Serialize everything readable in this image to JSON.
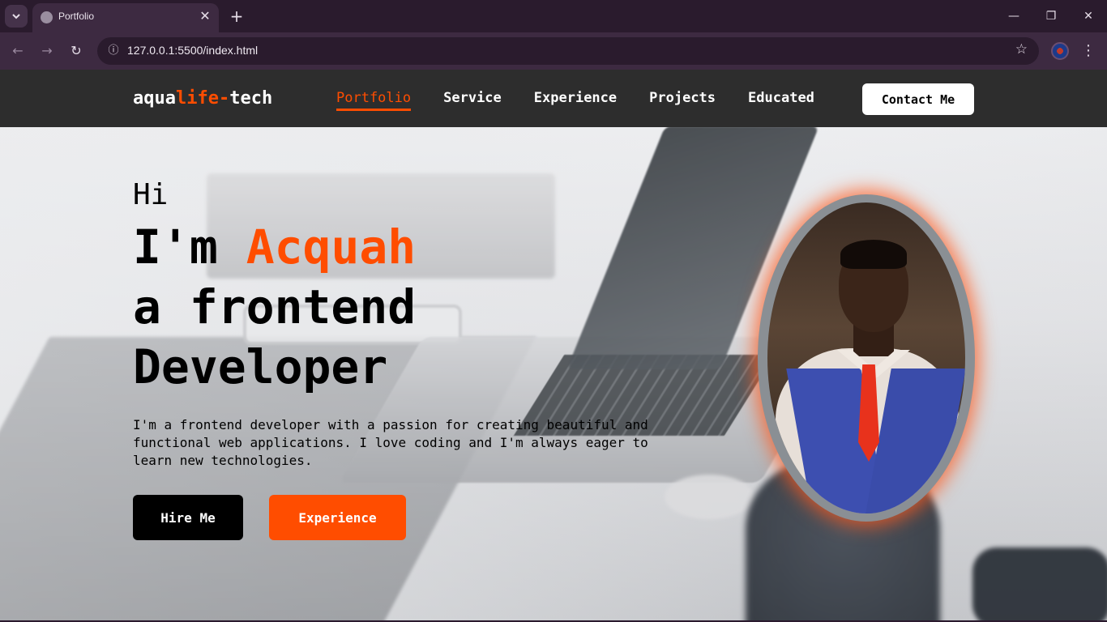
{
  "browser": {
    "tab_title": "Portfolio",
    "url": "127.0.0.1:5500/index.html",
    "icons": {
      "tab_list": "chevron-down-icon",
      "tab_close": "close-icon",
      "new_tab": "plus-icon",
      "back": "arrow-left-icon",
      "forward": "arrow-right-icon",
      "reload": "reload-icon",
      "site_info": "info-icon",
      "bookmark": "star-icon",
      "menu": "kebab-icon"
    }
  },
  "site": {
    "logo": {
      "part1": "aqua",
      "part2": "life-",
      "part3": "tech"
    },
    "nav": [
      {
        "label": "Portfolio",
        "active": true
      },
      {
        "label": "Service",
        "active": false
      },
      {
        "label": "Experience",
        "active": false
      },
      {
        "label": "Projects",
        "active": false
      },
      {
        "label": "Educated",
        "active": false
      }
    ],
    "contact_label": "Contact Me"
  },
  "hero": {
    "greeting": "Hi",
    "line1_prefix": "I'm ",
    "name": "Acquah",
    "line2": "a frontend",
    "line3": "Developer",
    "description": "I'm a frontend developer with a passion for creating beautiful and functional web applications. I love coding and I'm always eager to learn new technologies.",
    "hire_label": "Hire Me",
    "experience_label": "Experience"
  },
  "colors": {
    "accent": "#ff4d00",
    "header_bg": "#2d2d2d",
    "browser_frame": "#2a1b2d",
    "browser_toolbar": "#3d2a41"
  }
}
